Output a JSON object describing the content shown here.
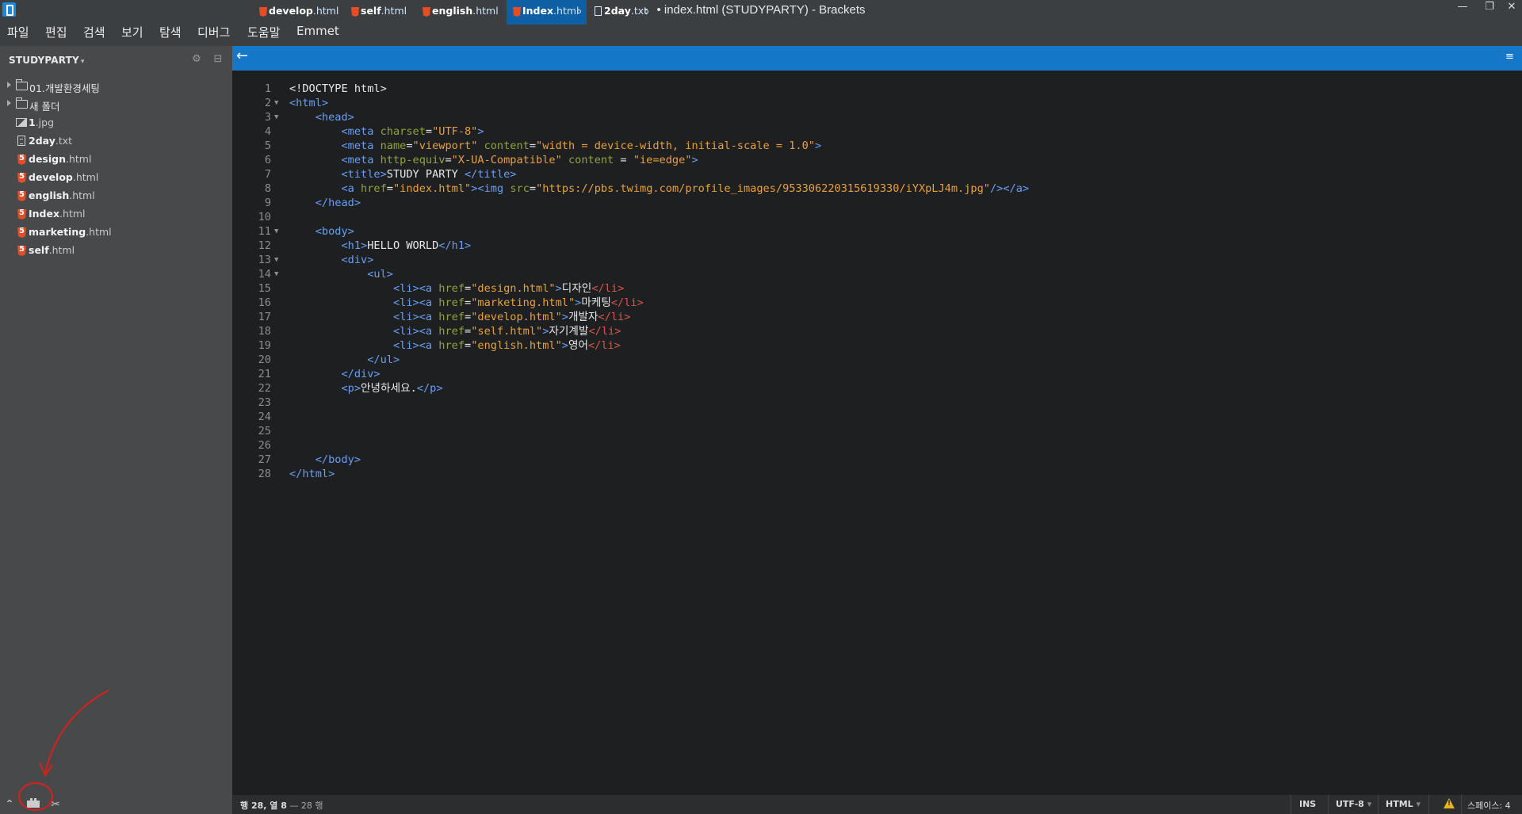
{
  "window": {
    "title": "• index.html (STUDYPARTY) - Brackets",
    "minimize": "—",
    "restore": "❐",
    "close": "✕"
  },
  "menu": [
    "파일",
    "편집",
    "검색",
    "보기",
    "탐색",
    "디버그",
    "도움말",
    "Emmet"
  ],
  "sidebar": {
    "project": "STUDYPARTY",
    "items": [
      {
        "type": "folder",
        "label": "01.개발환경세팅"
      },
      {
        "type": "folder",
        "label": "새 폴더"
      },
      {
        "type": "img",
        "name": "1",
        "ext": ".jpg"
      },
      {
        "type": "txt",
        "name": "2day",
        "ext": ".txt"
      },
      {
        "type": "html",
        "name": "design",
        "ext": ".html"
      },
      {
        "type": "html",
        "name": "develop",
        "ext": ".html"
      },
      {
        "type": "html",
        "name": "english",
        "ext": ".html"
      },
      {
        "type": "html",
        "name": "Index",
        "ext": ".html"
      },
      {
        "type": "html",
        "name": "marketing",
        "ext": ".html"
      },
      {
        "type": "html",
        "name": "self",
        "ext": ".html"
      }
    ]
  },
  "tabs": [
    {
      "name": "develop",
      "ext": ".html",
      "icon": "html5-icon",
      "active": false
    },
    {
      "name": "self",
      "ext": ".html",
      "icon": "html5-icon",
      "active": false
    },
    {
      "name": "english",
      "ext": ".html",
      "icon": "html5-icon",
      "active": false
    },
    {
      "name": "Index",
      "ext": ".html",
      "icon": "html5-icon",
      "active": true
    },
    {
      "name": "2day",
      "ext": ".txt",
      "icon": "text-file-icon",
      "active": false
    }
  ],
  "code_lines": [
    "<!DOCTYPE html>",
    "<html>",
    "    <head>",
    "        <meta charset=\"UTF-8\">",
    "        <meta name=\"viewport\" content=\"width = device-width, initial-scale = 1.0\">",
    "        <meta http-equiv=\"X-UA-Compatible\" content = \"ie=edge\">",
    "        <title>STUDY PARTY </title>",
    "        <a href=\"index.html\"><img src=\"https://pbs.twimg.com/profile_images/953306220315619330/iYXpLJ4m.jpg\"/></a>",
    "    </head>",
    "",
    "    <body>",
    "        <h1>HELLO WORLD</h1>",
    "        <div>",
    "            <ul>",
    "                <li><a href=\"design.html\">디자인</li>",
    "                <li><a href=\"marketing.html\">마케팅</li>",
    "                <li><a href=\"develop.html\">개발자</li>",
    "                <li><a href=\"self.html\">자기계발</li>",
    "                <li><a href=\"english.html\">영어</li>",
    "            </ul>",
    "        </div>",
    "        <p>안녕하세요.</p>",
    "",
    "",
    "",
    "",
    "    </body>",
    "</html>"
  ],
  "fold_lines": [
    2,
    3,
    11,
    13,
    14
  ],
  "status": {
    "cursor": "행 28, 열 8",
    "lines": "— 28 행",
    "mode": "INS",
    "encoding": "UTF-8",
    "language": "HTML",
    "indent": "스페이스: 4"
  },
  "colors": {
    "tabbar": "#1577c7",
    "sidebar": "#47494b",
    "editor_bg": "#1d1f21",
    "annotation": "#d9201b"
  }
}
